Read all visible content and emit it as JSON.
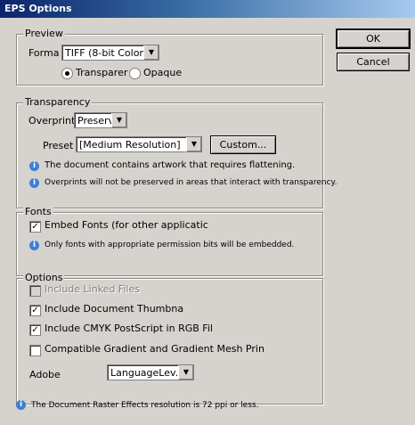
{
  "window": {
    "title": "EPS Options"
  },
  "buttons": {
    "ok": "OK",
    "cancel": "Cancel"
  },
  "preview": {
    "legend": "Preview",
    "format_label": "Forma",
    "format_value": "TIFF (8-bit Color)",
    "transparent_label": "Transparer",
    "opaque_label": "Opaque",
    "selected": "transparent"
  },
  "transparency": {
    "legend": "Transparency",
    "overprint_label": "Overprint",
    "overprint_value": "Preserve",
    "preset_label": "Preset",
    "preset_value": "[Medium Resolution]",
    "custom_button": "Custom...",
    "info1": "The document contains artwork that requires flattening.",
    "info2": "Overprints will not be preserved in areas that interact with transparency."
  },
  "fonts": {
    "legend": "Fonts",
    "embed_label": "Embed Fonts (for other applicatic",
    "embed_checked": true,
    "info": "Only fonts with appropriate permission bits will be embedded."
  },
  "options": {
    "legend": "Options",
    "linked_label": "Include Linked Files",
    "linked_checked": false,
    "thumbnail_label": "Include Document Thumbna",
    "thumbnail_checked": true,
    "cmyk_label": "Include CMYK PostScript in RGB Fil",
    "cmyk_checked": true,
    "gradient_label": "Compatible Gradient and Gradient Mesh Prin",
    "gradient_checked": false,
    "adobe_label": "Adobe",
    "adobe_value": "LanguageLev..."
  },
  "footer": {
    "info": "The Document Raster Effects resolution is 72 ppi or less."
  },
  "icons": {
    "info": "info-icon",
    "check": "✓",
    "dropdown": "▼"
  }
}
